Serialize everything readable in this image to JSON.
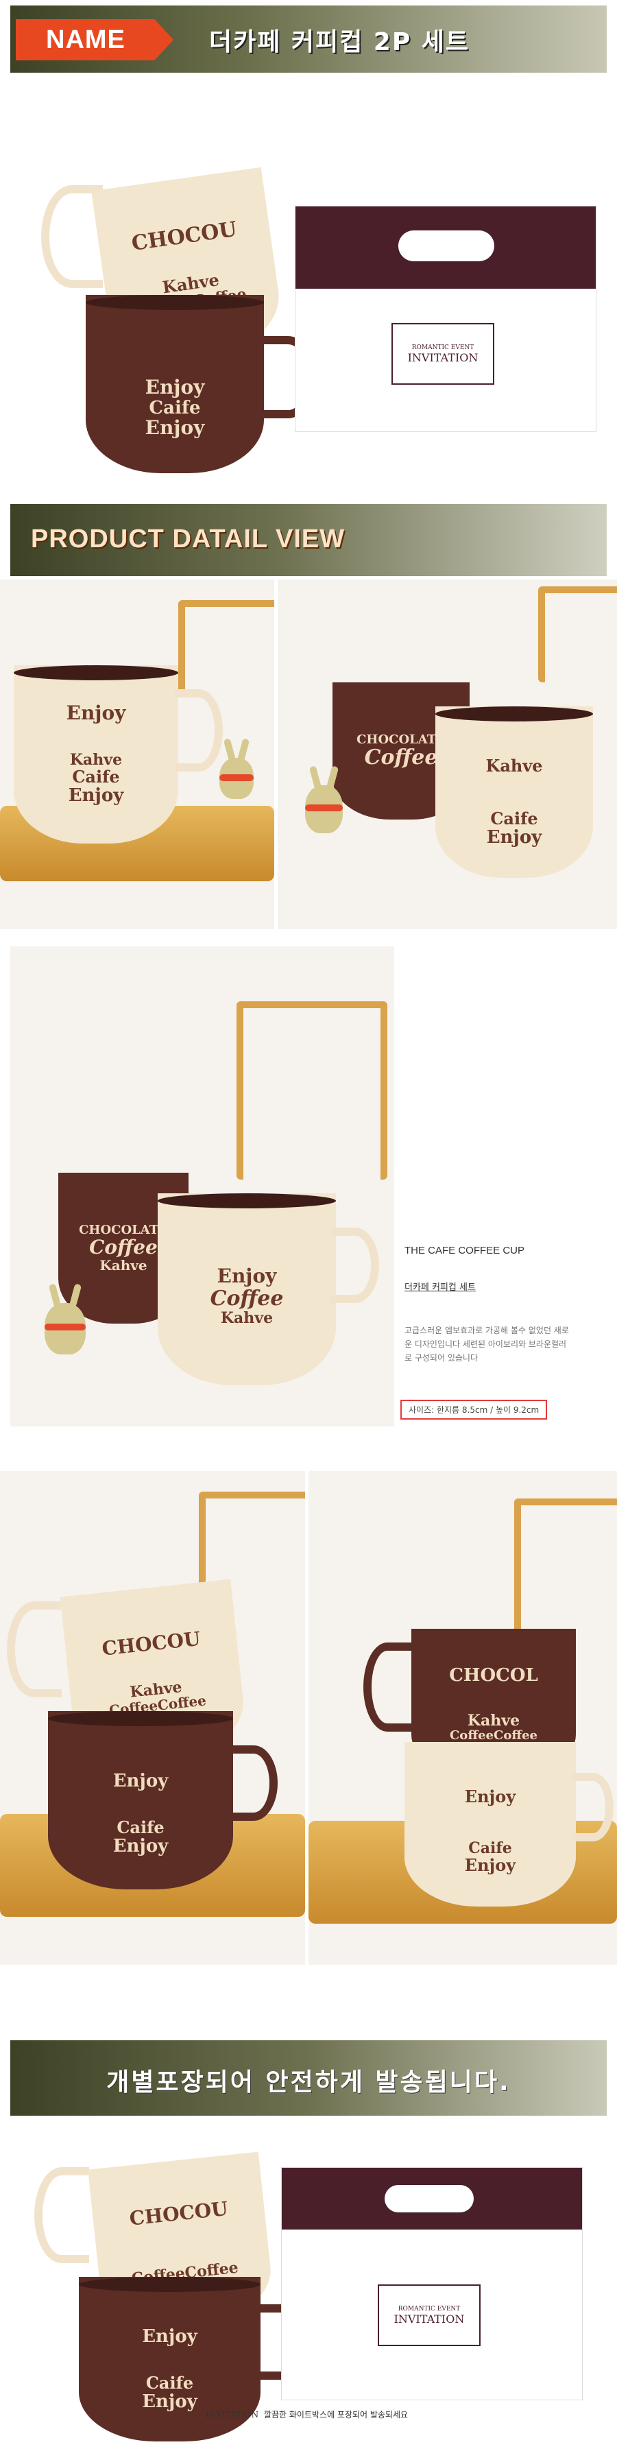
{
  "header": {
    "name_tag": "NAME",
    "product_title": "더카페 커피컵 2P 세트"
  },
  "detail": {
    "section_title": "PRODUCT DATAIL VIEW"
  },
  "mug_text": {
    "chocolate": "CHOCOLATE",
    "chocou": "CHOCOU",
    "chocol": "CHOCOL",
    "coffee": "Coffee",
    "kahve": "Kahve",
    "coffeecoffee": "CoffeeCoffee",
    "enjoy": "Enjoy",
    "caife": "Caife"
  },
  "box": {
    "line1": "ROMANTIC EVENT",
    "line2": "INVITATION"
  },
  "spec": {
    "title": "THE CAFE COFFEE CUP",
    "name": "더카페 커피컵 세트",
    "description": "고급스러운 엠보효과로 가공해 볼수 없었던 새로운 디자인입니다 세련된 아이보리와 브라운컬러로 구성되어 있습니다",
    "size": "사이즈: 한지름 8.5cm / 높이 9.2cm"
  },
  "shipping": {
    "title": "개별포장되어 안전하게 발송됩니다.",
    "caption_brand": "INVITATION",
    "caption_text": "깔끔한 화이트박스에 포장되어 발송되세요"
  },
  "colors": {
    "name_tag": "#e8481f",
    "banner_dark": "#3d4226",
    "mug_brown": "#5b2d24",
    "mug_cream": "#f3e6cf",
    "box_lid": "#4b1f2a",
    "size_border": "#e23b3b"
  }
}
